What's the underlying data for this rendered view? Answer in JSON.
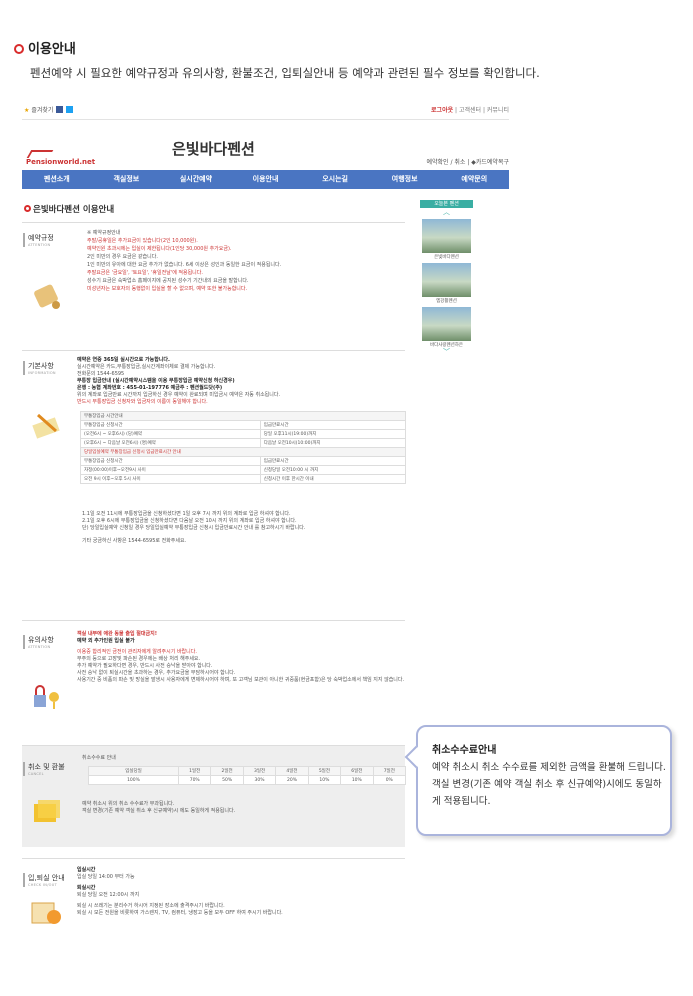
{
  "intro": {
    "title": "이용안내",
    "desc": "펜션예약 시 필요한 예약규정과 유의사항, 환불조건, 입퇴실안내 등 예약과 관련된 필수 정보를 확인합니다."
  },
  "topbar": {
    "favorite": "즐겨찾기",
    "links": [
      "로그아웃",
      "고객센터",
      "커뮤니티"
    ]
  },
  "header": {
    "logo": "Pensionworld.net",
    "site_title": "은빛바다펜션",
    "links": [
      "예약확인 / 취소",
      "카드예약복구"
    ]
  },
  "nav": [
    "펜션소개",
    "객실정보",
    "실시간예약",
    "이용안내",
    "오시는길",
    "여행정보",
    "예약문의"
  ],
  "page_title": "은빛바다펜션 이용안내",
  "right_panel": {
    "header": "오늘본 펜션",
    "items": [
      "은빛바다펜션",
      "엠강활펜션",
      "바다사랑펜션하은"
    ]
  },
  "sections": {
    "reserve": {
      "title": "예약규정",
      "sub": "ATTENTION",
      "head": "※ 예약규정안내",
      "lines": [
        "주말/공휴일은 추가요금이 있습니다(2인 10,000원).",
        "예약인원 초과시에는 입실이 제한됩니다(1인당 30,000원 추가요금).",
        "2인 미만의 경우 요금은 같습니다.",
        "1인 미만의 유아에 대한 요금 추가가 없습니다. 6세 이상은 성인과 동일한 요금이 적용됩니다.",
        "주말요금은 '금요일', '토요일', '휴일전날'에 적용됩니다.",
        "성수기 요금은 숙박업소 홈페이지에 공지된 성수기 기간내의 요금을 말합니다.",
        "미성년자는 보호자의 동행없이 입실을 할 수 없으며, 예약 또한 불가능합니다."
      ]
    },
    "basic": {
      "title": "기본사항",
      "sub": "INFORMATION",
      "lines": [
        "예약은 연중 365일 실시간으로 가능합니다.",
        "실시간예약은 카드,무통장입금,실시간계좌이체로 결제 가능합니다.",
        "전화문의 1544-6595",
        "무통장 입금안내 (실시간예약시스템을 이용 무통장입금 예약신청 하신경우)",
        "은행 : 농협   계좌번호 : 455-01-197776   예금주 : 펜션월드닷(주)",
        "위의 계좌로 입금만료 시간까지 입금하신 경우 예약이 완료되며 미입금시 예약은 자동 취소됩니다.",
        "반드시 무통장입금 신청자와 입금자의 이름이 동일해야 합니다."
      ],
      "table1": {
        "title": "무통장입금 시간안내",
        "head": [
          "무통장입금 신청시간",
          "입금만료시간"
        ],
        "rows": [
          [
            "(오전6시 ~ 오후6시) (당)예약",
            "당일 오후11시(19:00)까지"
          ],
          [
            "(오후6시 ~ 다음날 오전6시) (명)예약",
            "다음날 오전10시(10:00)까지"
          ]
        ]
      },
      "table2": {
        "title": "당일입실예약 무통장입금 신청시 입금만료시간 안내",
        "head": [
          "무통장입금 신청시간",
          "입금만료시간"
        ],
        "rows": [
          [
            "자정(00:00)이후~오전9시 사이",
            "신청당일 오전10:00 시 까지"
          ],
          [
            "오전 9시 이후~오후 5시 사이",
            "신청시간 이후 한시간 이내"
          ]
        ]
      },
      "notes": [
        "1.1일 오전 11시에 무통장입금을 신청하셨다면 1일 오후 7시 까지 위의 계좌로 입금 하셔야 합니다.",
        "2.1일 오후 6시에 무통장입금을 신청하셨다면 다음날 오전 10시 까지 위의 계좌로 입금 하셔야 합니다.",
        "단) 당일입실예약 신청일 경우 당일입실예약 무통장입금 신청시 입금만료시간 안내 를 참고하시기 바랍니다.",
        "기타 궁금하신 사항은 1544-6595로 전화주세요."
      ]
    },
    "caution": {
      "title": "유의사항",
      "sub": "ATTENTION",
      "lines": [
        "객실 내부에 애완 동물 출입 절대금지!",
        "예약 외 추가인원 입실 불가",
        "이용중 합리적인 금전이 관리자에게 알려주시기 바랍니다.",
        "부주의 등으로 고장및 파손된 경우에는 배상 처리 해주세요.",
        "추가 예약가 필요하다면 경우, 반드시 사전 승낙을 받아야 합니다.",
        "사전 승낙 없이 퇴실시간을 초과하는 경우, 추가요금을 부담하시어야 합니다.",
        "사용기간 중 비품의 파손 및 망실을 발생시 사용자에게 변제하시어야 하며, 또 고객님 보관이 아니한 귀중품(현금포함)은 당 숙박업소에서 책임 지지 않습니다."
      ]
    },
    "refund": {
      "title": "취소 및 환불",
      "sub": "CANCEL",
      "head": "취소수수료 안내",
      "cols": [
        "입실당일",
        "1일전",
        "2일전",
        "3일전",
        "4일전",
        "5일전",
        "6일전",
        "7일전"
      ],
      "vals": [
        "100%",
        "70%",
        "50%",
        "30%",
        "20%",
        "10%",
        "10%",
        "0%"
      ],
      "notes": [
        "예약 취소시 위의 취소 수수료가 부과됩니다.",
        "객실 변경(기존 예약 객실 취소 후 신규예약)시 에도 동일하게 적용됩니다."
      ]
    },
    "checkin": {
      "title": "입,퇴실 안내",
      "sub": "CHECK IN/OUT",
      "lines": [
        "입실시간",
        "입실 당일 14:00 부터 가능",
        "퇴실시간",
        "퇴실 당일 오전 12:00시 까지",
        "퇴실 시 쓰레기는 분리수거 하시어 지정된 장소에 출격주시기 바랍니다.",
        "퇴실 시 모든 전원을 비롯하여 가스렌지, TV, 컴퓨터, 냉장고 등을 모두 OFF 하여 주시기 바랍니다."
      ]
    }
  },
  "tooltip": {
    "title": "취소수수료안내",
    "body": "예약 취소시 취소 수수료를 제외한 금액을 환불해 드립니다. 객실 변경(기존 예약 객실 취소 후 신규예약)시에도 동일하게 적용됩니다."
  }
}
